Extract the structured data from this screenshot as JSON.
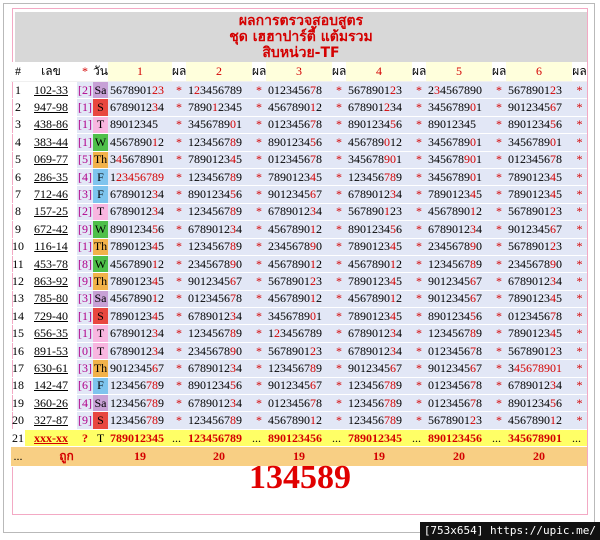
{
  "header": {
    "line1": "ผลการตรวจสอบสูตร",
    "line2": "ชุด เฮฮาปาร์ตี้ แต้มรวม",
    "line3": "สิบหน่วย-TF"
  },
  "columns": {
    "idx": "#",
    "code": "เลข",
    "star": "*",
    "day": "วัน",
    "sets": [
      "1",
      "2",
      "3",
      "4",
      "5",
      "6"
    ],
    "pl": "ผล"
  },
  "rows": [
    {
      "n": "1",
      "code": "102-33",
      "br": "[2]",
      "day": "Sa",
      "vals": [
        "5678901",
        "12",
        "3"
      ],
      "cells": [
        [
          "5678901",
          "23",
          ""
        ],
        [
          "1",
          "2",
          "3456789"
        ],
        [
          "0123456",
          "7",
          "8"
        ],
        [
          "5678901",
          "2",
          "3"
        ],
        [
          "2",
          "3",
          "4567890"
        ],
        [
          "5678901",
          "2",
          "3"
        ]
      ]
    },
    {
      "n": "2",
      "code": "947-98",
      "br": "[1]",
      "day": "S",
      "cells": [
        [
          "6789012",
          "3",
          "4"
        ],
        [
          "7890",
          "1",
          "2345"
        ],
        [
          "4567890",
          "1",
          "2"
        ],
        [
          "678901",
          "2",
          "34"
        ],
        [
          "3456789",
          "0",
          "1"
        ],
        [
          "9012345",
          "6",
          "7"
        ]
      ]
    },
    {
      "n": "3",
      "code": "438-86",
      "br": "[1]",
      "day": "T",
      "cells": [
        [
          "89012345",
          "",
          ""
        ],
        [
          "3456789",
          "0",
          "1"
        ],
        [
          "0123456",
          "7",
          "8"
        ],
        [
          "8901234",
          "5",
          "6"
        ],
        [
          "89012345",
          "",
          ""
        ],
        [
          "8901234",
          "5",
          "6"
        ]
      ]
    },
    {
      "n": "4",
      "code": "383-44",
      "br": "[1]",
      "day": "W",
      "cells": [
        [
          "4567890",
          "1",
          "2"
        ],
        [
          "1234567",
          "8",
          "9"
        ],
        [
          "8901234",
          "5",
          "6"
        ],
        [
          "456789",
          "0",
          "12"
        ],
        [
          "3456789",
          "0",
          "1"
        ],
        [
          "3456789",
          "0",
          "1"
        ]
      ]
    },
    {
      "n": "5",
      "code": "069-77",
      "br": "[5]",
      "day": "Th",
      "cells": [
        [
          "3",
          "4",
          "5678901"
        ],
        [
          "7890123",
          "4",
          "5"
        ],
        [
          "0123456",
          "7",
          "8"
        ],
        [
          "345678",
          "90",
          "1"
        ],
        [
          "345678",
          "90",
          "1"
        ],
        [
          "0123456",
          "7",
          "8"
        ]
      ]
    },
    {
      "n": "6",
      "code": "286-35",
      "br": "[4]",
      "day": "F",
      "cells": [
        [
          "1",
          "23456789",
          ""
        ],
        [
          "1234567",
          "8",
          "9"
        ],
        [
          "7890123",
          "4",
          "5"
        ],
        [
          "123456",
          "78",
          "9"
        ],
        [
          "3456789",
          "0",
          "1"
        ],
        [
          "7890123",
          "4",
          "5"
        ]
      ]
    },
    {
      "n": "7",
      "code": "712-46",
      "br": "[3]",
      "day": "F",
      "cells": [
        [
          "6789012",
          "3",
          "4"
        ],
        [
          "8901234",
          "5",
          "6"
        ],
        [
          "9012345",
          "6",
          "7"
        ],
        [
          "6789012",
          "3",
          "4"
        ],
        [
          "7890123",
          "4",
          "5"
        ],
        [
          "7890123",
          "4",
          "5"
        ]
      ]
    },
    {
      "n": "8",
      "code": "157-25",
      "br": "[2]",
      "day": "T",
      "cells": [
        [
          "6789012",
          "3",
          "4"
        ],
        [
          "1234567",
          "8",
          "9"
        ],
        [
          "6789012",
          "3",
          "4"
        ],
        [
          "567890",
          "1",
          "23"
        ],
        [
          "4567890",
          "1",
          "2"
        ],
        [
          "5678901",
          "2",
          "3"
        ]
      ]
    },
    {
      "n": "9",
      "code": "672-42",
      "br": "[9]",
      "day": "W",
      "cells": [
        [
          "8901234",
          "5",
          "6"
        ],
        [
          "6789012",
          "3",
          "4"
        ],
        [
          "4567890",
          "1",
          "2"
        ],
        [
          "8901234",
          "5",
          "6"
        ],
        [
          "6789012",
          "3",
          "4"
        ],
        [
          "9012345",
          "6",
          "7"
        ]
      ]
    },
    {
      "n": "10",
      "code": "116-14",
      "br": "[1]",
      "day": "Th",
      "cells": [
        [
          "7890123",
          "4",
          "5"
        ],
        [
          "1234567",
          "8",
          "9"
        ],
        [
          "2345678",
          "9",
          "0"
        ],
        [
          "7890123",
          "4",
          "5"
        ],
        [
          "2345678",
          "9",
          "0"
        ],
        [
          "5678901",
          "2",
          "3"
        ]
      ]
    },
    {
      "n": "11",
      "code": "453-78",
      "br": "[8]",
      "day": "W",
      "cells": [
        [
          "4567890",
          "1",
          "2"
        ],
        [
          "2345678",
          "9",
          "0"
        ],
        [
          "4567890",
          "1",
          "2"
        ],
        [
          "4567890",
          "1",
          "2"
        ],
        [
          "1234567",
          "8",
          "9"
        ],
        [
          "2345678",
          "9",
          "0"
        ]
      ]
    },
    {
      "n": "12",
      "code": "863-92",
      "br": "[9]",
      "day": "Th",
      "cells": [
        [
          "7890123",
          "4",
          "5"
        ],
        [
          "9012345",
          "6",
          "7"
        ],
        [
          "5678901",
          "2",
          "3"
        ],
        [
          "7890123",
          "4",
          "5"
        ],
        [
          "9012345",
          "6",
          "7"
        ],
        [
          "6789012",
          "3",
          "4"
        ]
      ]
    },
    {
      "n": "13",
      "code": "785-80",
      "br": "[3]",
      "day": "Sa",
      "cells": [
        [
          "4567890",
          "1",
          "2"
        ],
        [
          "0123456",
          "7",
          "8"
        ],
        [
          "4567890",
          "1",
          "2"
        ],
        [
          "4567890",
          "1",
          "2"
        ],
        [
          "9012345",
          "6",
          "7"
        ],
        [
          "7890123",
          "4",
          "5"
        ]
      ]
    },
    {
      "n": "14",
      "code": "729-40",
      "br": "[1]",
      "day": "S",
      "cells": [
        [
          "7890123",
          "4",
          "5"
        ],
        [
          "6789012",
          "3",
          "4"
        ],
        [
          "3456789",
          "0",
          "1"
        ],
        [
          "7890123",
          "4",
          "5"
        ],
        [
          "8901234",
          "5",
          "6"
        ],
        [
          "0123456",
          "7",
          "8"
        ]
      ]
    },
    {
      "n": "15",
      "code": "656-35",
      "br": "[1]",
      "day": "T",
      "cells": [
        [
          "6789012",
          "3",
          "4"
        ],
        [
          "1234567",
          "8",
          "9"
        ],
        [
          "1",
          "2",
          "3456789"
        ],
        [
          "6789012",
          "3",
          "4"
        ],
        [
          "1234567",
          "8",
          "9"
        ],
        [
          "7890123",
          "4",
          "5"
        ]
      ]
    },
    {
      "n": "16",
      "code": "891-53",
      "br": "[0]",
      "day": "T",
      "cells": [
        [
          "6789012",
          "3",
          "4"
        ],
        [
          "2345678",
          "9",
          "0"
        ],
        [
          "5678901",
          "2",
          "3"
        ],
        [
          "6789012",
          "3",
          "4"
        ],
        [
          "0123456",
          "7",
          "8"
        ],
        [
          "5678901",
          "2",
          "3"
        ]
      ]
    },
    {
      "n": "17",
      "code": "630-61",
      "br": "[3]",
      "day": "Th",
      "cells": [
        [
          "9012345",
          "6",
          "7"
        ],
        [
          "6789012",
          "3",
          "4"
        ],
        [
          "1234567",
          "8",
          "9"
        ],
        [
          "9012345",
          "6",
          "7"
        ],
        [
          "9012345",
          "6",
          "7"
        ],
        [
          "3",
          "45678901",
          ""
        ]
      ]
    },
    {
      "n": "18",
      "code": "142-47",
      "br": "[6]",
      "day": "F",
      "cells": [
        [
          "123456",
          "78",
          "9"
        ],
        [
          "8901234",
          "5",
          "6"
        ],
        [
          "9012345",
          "6",
          "7"
        ],
        [
          "123456",
          "78",
          "9"
        ],
        [
          "0123456",
          "7",
          "8"
        ],
        [
          "6789012",
          "3",
          "4"
        ]
      ]
    },
    {
      "n": "19",
      "code": "360-26",
      "br": "[4]",
      "day": "Sa",
      "cells": [
        [
          "123456",
          "78",
          "9"
        ],
        [
          "6789012",
          "3",
          "4"
        ],
        [
          "0123456",
          "7",
          "8"
        ],
        [
          "123456",
          "78",
          "9"
        ],
        [
          "0123456",
          "7",
          "8"
        ],
        [
          "8901234",
          "5",
          "6"
        ]
      ]
    },
    {
      "n": "20",
      "code": "327-87",
      "br": "[9]",
      "day": "S",
      "cells": [
        [
          "123456",
          "78",
          "9"
        ],
        [
          "1234567",
          "8",
          "9"
        ],
        [
          "4567890",
          "1",
          "2"
        ],
        [
          "123456",
          "78",
          "9"
        ],
        [
          "5678901",
          "2",
          "3"
        ],
        [
          "4567890",
          "1",
          "2"
        ]
      ]
    }
  ],
  "row21": {
    "n": "21",
    "code": "xxx-xx",
    "br": "?",
    "day": "T",
    "vals": [
      "789012345",
      "123456789",
      "890123456",
      "789012345",
      "890123456",
      "345678901"
    ],
    "dots": "..."
  },
  "hits": {
    "dots": "...",
    "label": "ถูก",
    "vals": [
      "19",
      "20",
      "19",
      "19",
      "20",
      "20"
    ]
  },
  "result": "134589",
  "watermark": "[753x654] https://upic.me/"
}
